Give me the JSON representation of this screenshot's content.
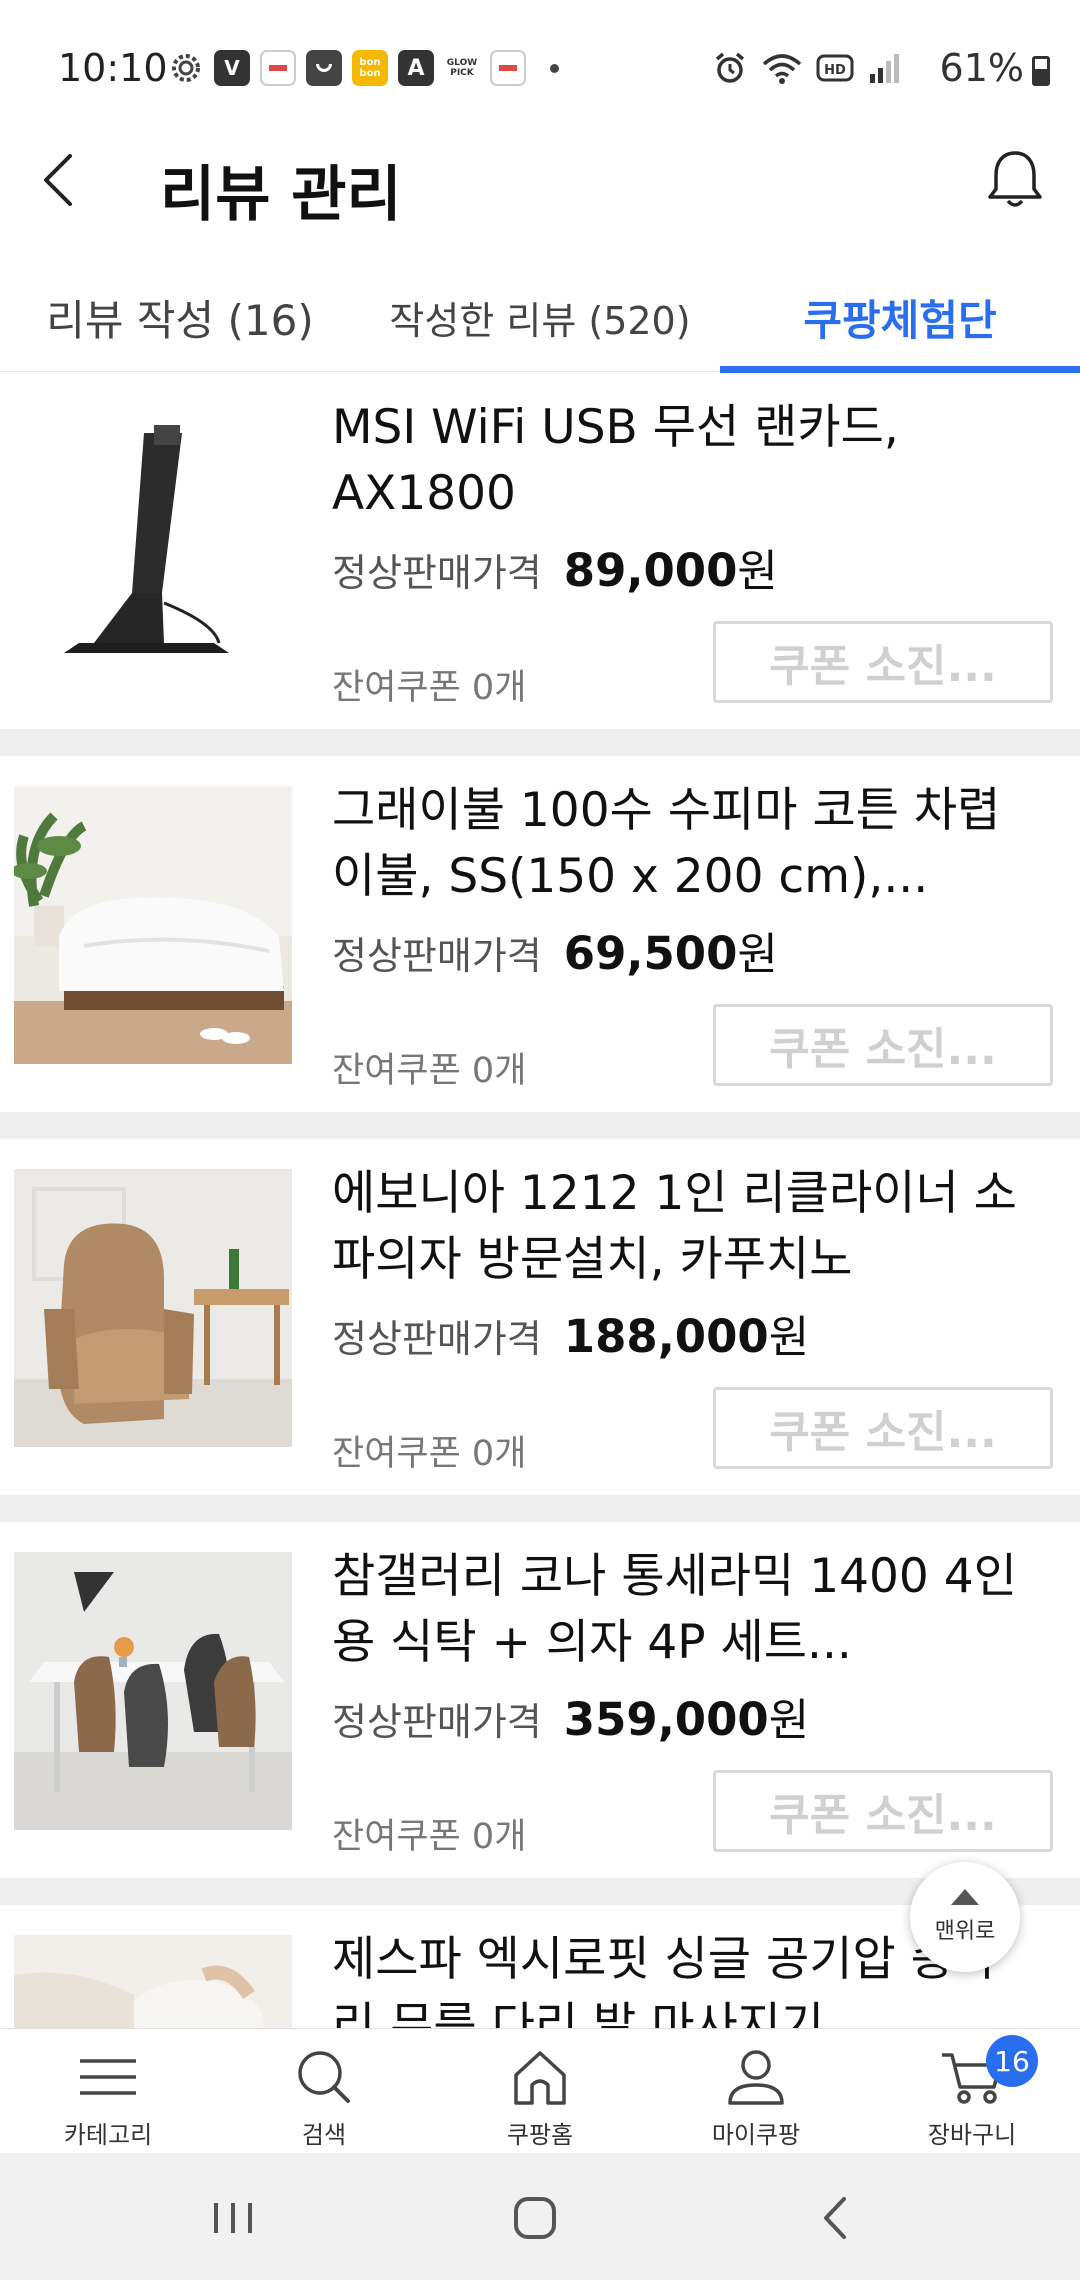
{
  "status_bar": {
    "time": "10:10",
    "battery": "61%",
    "left_icons": [
      {
        "name": "settings-gear-icon",
        "text": "",
        "color": "#444444"
      },
      {
        "name": "vs-app-icon",
        "text": "V",
        "color": "#333333"
      },
      {
        "name": "app-badge-icon-1",
        "text": "",
        "color": "#e04848"
      },
      {
        "name": "coupang-app-icon",
        "text": "",
        "color": "#444444"
      },
      {
        "name": "bonbon-app-icon",
        "text": "bon bon",
        "color": "#f5b800"
      },
      {
        "name": "a-app-icon",
        "text": "A",
        "color": "#333333"
      },
      {
        "name": "glowpick-app-icon",
        "text": "GLOW PICK",
        "color": "#ffffff"
      },
      {
        "name": "app-badge-icon-2",
        "text": "",
        "color": "#e04848"
      }
    ]
  },
  "header": {
    "title": "리뷰 관리"
  },
  "tabs": [
    {
      "label": "리뷰 작성 (16)",
      "active": false
    },
    {
      "label": "작성한 리뷰 (520)",
      "active": false
    },
    {
      "label": "쿠팡체험단",
      "active": true
    }
  ],
  "products": [
    {
      "name": "MSI WiFi USB 무선 랜카드, AX1800",
      "price_label": "정상판매가격",
      "price": "89,000",
      "price_unit": "원",
      "coupon_remaining": "잔여쿠폰 0개",
      "coupon_button": "쿠폰 소진...",
      "image": "usb-wifi-adapter"
    },
    {
      "name": "그래이불 100수 수피마 코튼 차렵이불, SS(150 x 200 cm),...",
      "price_label": "정상판매가격",
      "price": "69,500",
      "price_unit": "원",
      "coupon_remaining": "잔여쿠폰 0개",
      "coupon_button": "쿠폰 소진...",
      "image": "white-bedding"
    },
    {
      "name": "에보니아 1212 1인 리클라이너 소파의자 방문설치, 카푸치노",
      "price_label": "정상판매가격",
      "price": "188,000",
      "price_unit": "원",
      "coupon_remaining": "잔여쿠폰 0개",
      "coupon_button": "쿠폰 소진...",
      "image": "recliner-chair"
    },
    {
      "name": "참갤러리 코나 통세라믹 1400 4인용 식탁 + 의자 4P 세트...",
      "price_label": "정상판매가격",
      "price": "359,000",
      "price_unit": "원",
      "coupon_remaining": "잔여쿠폰 0개",
      "coupon_button": "쿠폰 소진...",
      "image": "dining-table-set"
    },
    {
      "name": "제스파 엑시로핏 싱글 공기압 종아리 무릎 다리 발 마사지기",
      "price_label": "",
      "price": "",
      "price_unit": "",
      "coupon_remaining": "",
      "coupon_button": "",
      "image": "leg-massager"
    }
  ],
  "scroll_top": {
    "label": "맨위로"
  },
  "bottom_nav": [
    {
      "label": "카테고리",
      "icon": "menu-icon"
    },
    {
      "label": "검색",
      "icon": "search-icon"
    },
    {
      "label": "쿠팡홈",
      "icon": "home-icon"
    },
    {
      "label": "마이쿠팡",
      "icon": "person-icon"
    },
    {
      "label": "장바구니",
      "icon": "cart-icon",
      "badge": "16"
    }
  ],
  "colors": {
    "accent": "#2a6ef0",
    "divider": "#efefef",
    "disabled_text": "#d0d0d0"
  }
}
